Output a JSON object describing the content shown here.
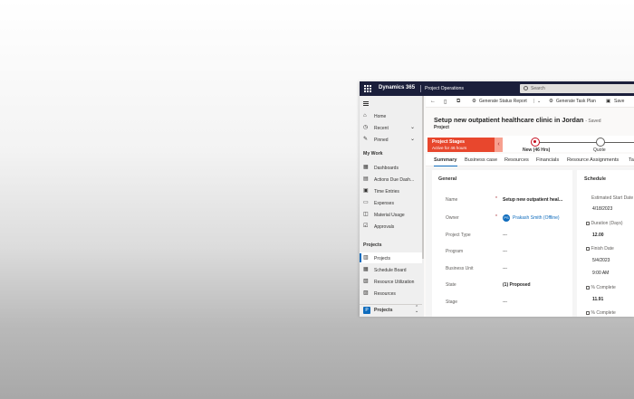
{
  "topbar": {
    "brand": "Dynamics 365",
    "app_name": "Project Operations",
    "search_placeholder": "Search"
  },
  "sidebar": {
    "top_items": [
      {
        "label": "Home",
        "icon": "home-icon"
      },
      {
        "label": "Recent",
        "icon": "clock-icon"
      },
      {
        "label": "Pinned",
        "icon": "pin-icon"
      }
    ],
    "sections": [
      {
        "title": "My Work",
        "items": [
          {
            "label": "Dashboards",
            "icon": "dashboard-icon"
          },
          {
            "label": "Actions Due Dash...",
            "icon": "actions-icon"
          },
          {
            "label": "Time Entries",
            "icon": "calendar-icon"
          },
          {
            "label": "Expenses",
            "icon": "receipt-icon"
          },
          {
            "label": "Material Usage",
            "icon": "box-icon"
          },
          {
            "label": "Approvals",
            "icon": "check-icon"
          }
        ]
      },
      {
        "title": "Projects",
        "items": [
          {
            "label": "Projects",
            "icon": "project-icon",
            "active": true
          },
          {
            "label": "Schedule Board",
            "icon": "board-icon"
          },
          {
            "label": "Resource Utilization",
            "icon": "chart-icon"
          },
          {
            "label": "Resources",
            "icon": "people-icon"
          }
        ]
      }
    ],
    "area": {
      "initial": "P",
      "label": "Projects"
    }
  },
  "commandbar": {
    "generate_status_report": "Generate Status Report",
    "generate_task_plan": "Generate Task Plan",
    "save": "Save"
  },
  "record": {
    "title": "Setup new outpatient healthcare clinic in Jordan",
    "saved": "- Saved",
    "type": "Project"
  },
  "bpf": {
    "stage_title": "Project Stages",
    "stage_sub": "Active for 46 hours",
    "stages": [
      {
        "name": "New",
        "duration": "(46 Hrs)"
      },
      {
        "name": "Quote",
        "duration": ""
      }
    ]
  },
  "tabs": [
    "Summary",
    "Business case",
    "Resources",
    "Financials",
    "Resource Assignments",
    "Ta"
  ],
  "general": {
    "title": "General",
    "fields": [
      {
        "label": "Name",
        "required": true,
        "value": "Setup new outpatient heal..."
      },
      {
        "label": "Owner",
        "required": true,
        "value": "Prakash Smith (Offline)",
        "initials": "PS"
      },
      {
        "label": "Project Type",
        "value": "---"
      },
      {
        "label": "Program",
        "value": "---"
      },
      {
        "label": "Business Unit",
        "value": "---"
      },
      {
        "label": "State",
        "value": "(1) Proposed"
      },
      {
        "label": "Stage",
        "value": "---"
      }
    ]
  },
  "schedule": {
    "title": "Schedule",
    "fields": [
      {
        "label": "Estimated Start Date",
        "value": "4/18/2023"
      },
      {
        "label": "Duration (Days)",
        "value": "12.00"
      },
      {
        "label": "Finish Date",
        "value": "5/4/2023",
        "value2": "9:00 AM"
      },
      {
        "label": "% Complete",
        "value": "11.91"
      },
      {
        "label": "% Complete",
        "value": ""
      }
    ]
  },
  "colors": {
    "topbar": "#1b1f3b",
    "accent": "#0f6cbd",
    "stage_active": "#e8472d"
  }
}
